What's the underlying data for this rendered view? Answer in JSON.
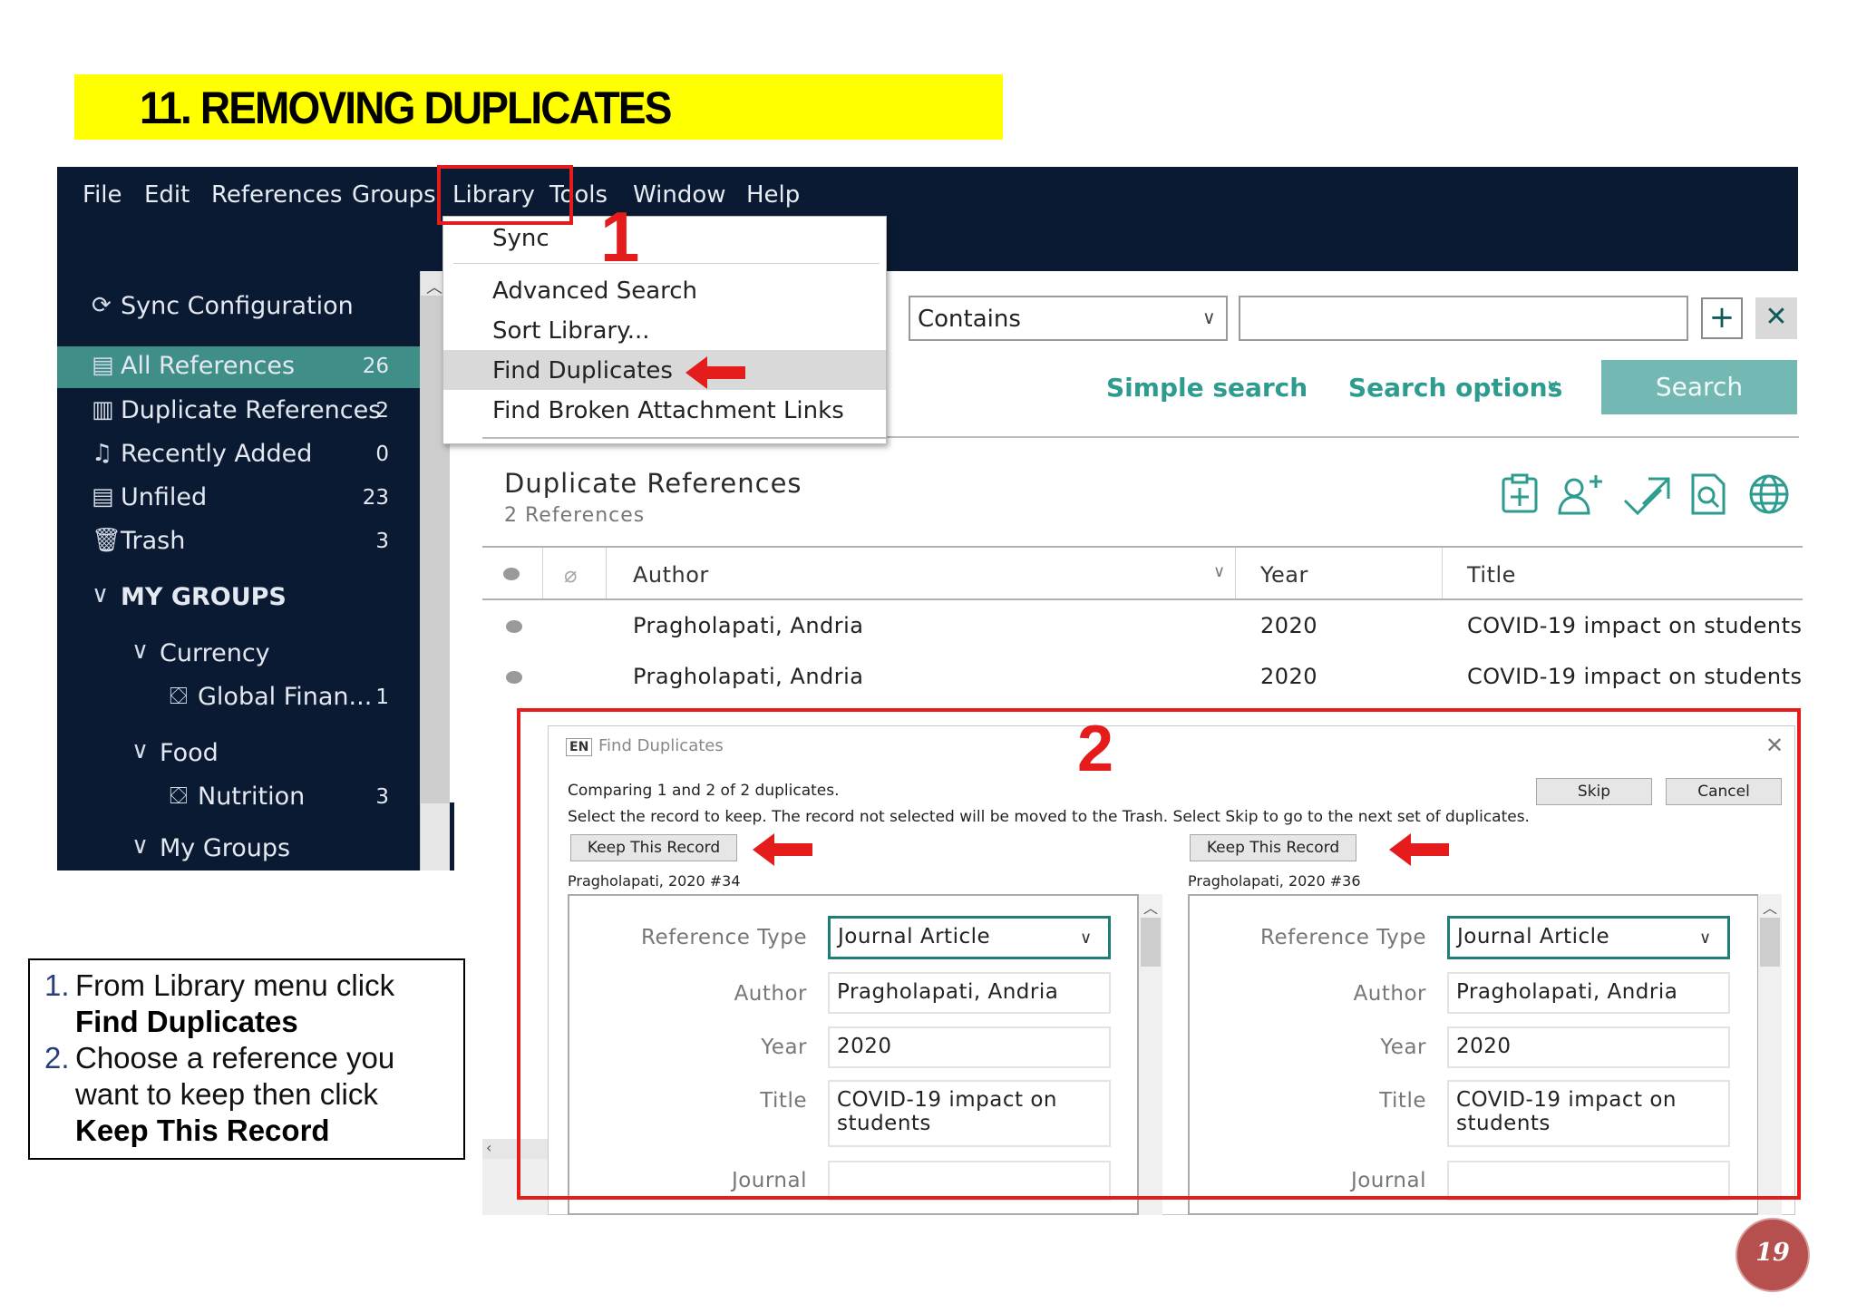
{
  "slide": {
    "title": "11. REMOVING DUPLICATES",
    "page_number": "19"
  },
  "menubar": {
    "items": [
      "File",
      "Edit",
      "References",
      "Groups",
      "Library",
      "Tools",
      "Window",
      "Help"
    ]
  },
  "library_menu": {
    "items": [
      "Sync",
      "Advanced Search",
      "Sort Library...",
      "Find Duplicates",
      "Find Broken Attachment Links"
    ],
    "highlighted": "Find Duplicates"
  },
  "sidebar": {
    "sync_label": "Sync Configuration",
    "items": [
      {
        "label": "All References",
        "count": "26",
        "icon": "clipboard-icon"
      },
      {
        "label": "Duplicate References",
        "count": "2",
        "icon": "duplicate-icon"
      },
      {
        "label": "Recently Added",
        "count": "0",
        "icon": "bell-icon"
      },
      {
        "label": "Unfiled",
        "count": "23",
        "icon": "document-icon"
      },
      {
        "label": "Trash",
        "count": "3",
        "icon": "trash-icon"
      }
    ],
    "my_groups_header": "MY GROUPS",
    "group_sets": [
      {
        "label": "Currency",
        "groups": [
          {
            "label": "Global Finan...",
            "count": "1"
          }
        ]
      },
      {
        "label": "Food",
        "groups": [
          {
            "label": "Nutrition",
            "count": "3"
          }
        ]
      },
      {
        "label": "My Groups"
      }
    ]
  },
  "search": {
    "match_operator": "Contains",
    "search_value": "",
    "simple_search_label": "Simple search",
    "search_options_label": "Search options",
    "search_button_label": "Search",
    "add_symbol": "+",
    "remove_symbol": "✕"
  },
  "group_panel": {
    "title": "Duplicate References",
    "subtitle": "2 References",
    "toolbar_icons": [
      "add-reference-icon",
      "share-icon",
      "export-icon",
      "find-fulltext-icon",
      "online-search-icon"
    ]
  },
  "table": {
    "columns": [
      "Author",
      "Year",
      "Title"
    ],
    "rows": [
      {
        "author": "Pragholapati, Andria",
        "year": "2020",
        "title": "COVID-19 impact on students"
      },
      {
        "author": "Pragholapati, Andria",
        "year": "2020",
        "title": "COVID-19 impact on students"
      }
    ]
  },
  "dialog": {
    "lang_badge": "EN",
    "title": "Find Duplicates",
    "comparing_text": "Comparing 1 and 2 of 2 duplicates.",
    "instruction_text": "Select the record to keep. The record not selected will be moved to the Trash. Select Skip to go to the next set of duplicates.",
    "skip_label": "Skip",
    "cancel_label": "Cancel",
    "keep_label": "Keep This Record",
    "field_labels": {
      "reference_type": "Reference Type",
      "author": "Author",
      "year": "Year",
      "title": "Title",
      "journal": "Journal"
    },
    "records": [
      {
        "header": "Pragholapati, 2020 #34",
        "reference_type": "Journal Article",
        "author": "Pragholapati, Andria",
        "year": "2020",
        "title_line1": "COVID-19 impact on",
        "title_line2": "students",
        "journal": ""
      },
      {
        "header": "Pragholapati, 2020 #36",
        "reference_type": "Journal Article",
        "author": "Pragholapati, Andria",
        "year": "2020",
        "title_line1": "COVID-19 impact on",
        "title_line2": "students",
        "journal": ""
      }
    ]
  },
  "annotations": {
    "step1_marker": "1",
    "step2_marker": "2",
    "color": "#e51c1c"
  },
  "instructions": {
    "step1_num": "1.",
    "step1_line1": "From Library menu click",
    "step1_bold": "Find Duplicates",
    "step2_num": "2.",
    "step2_line1": "Choose a reference you",
    "step2_line2": "want to keep then click",
    "step2_bold": "Keep This Record"
  }
}
